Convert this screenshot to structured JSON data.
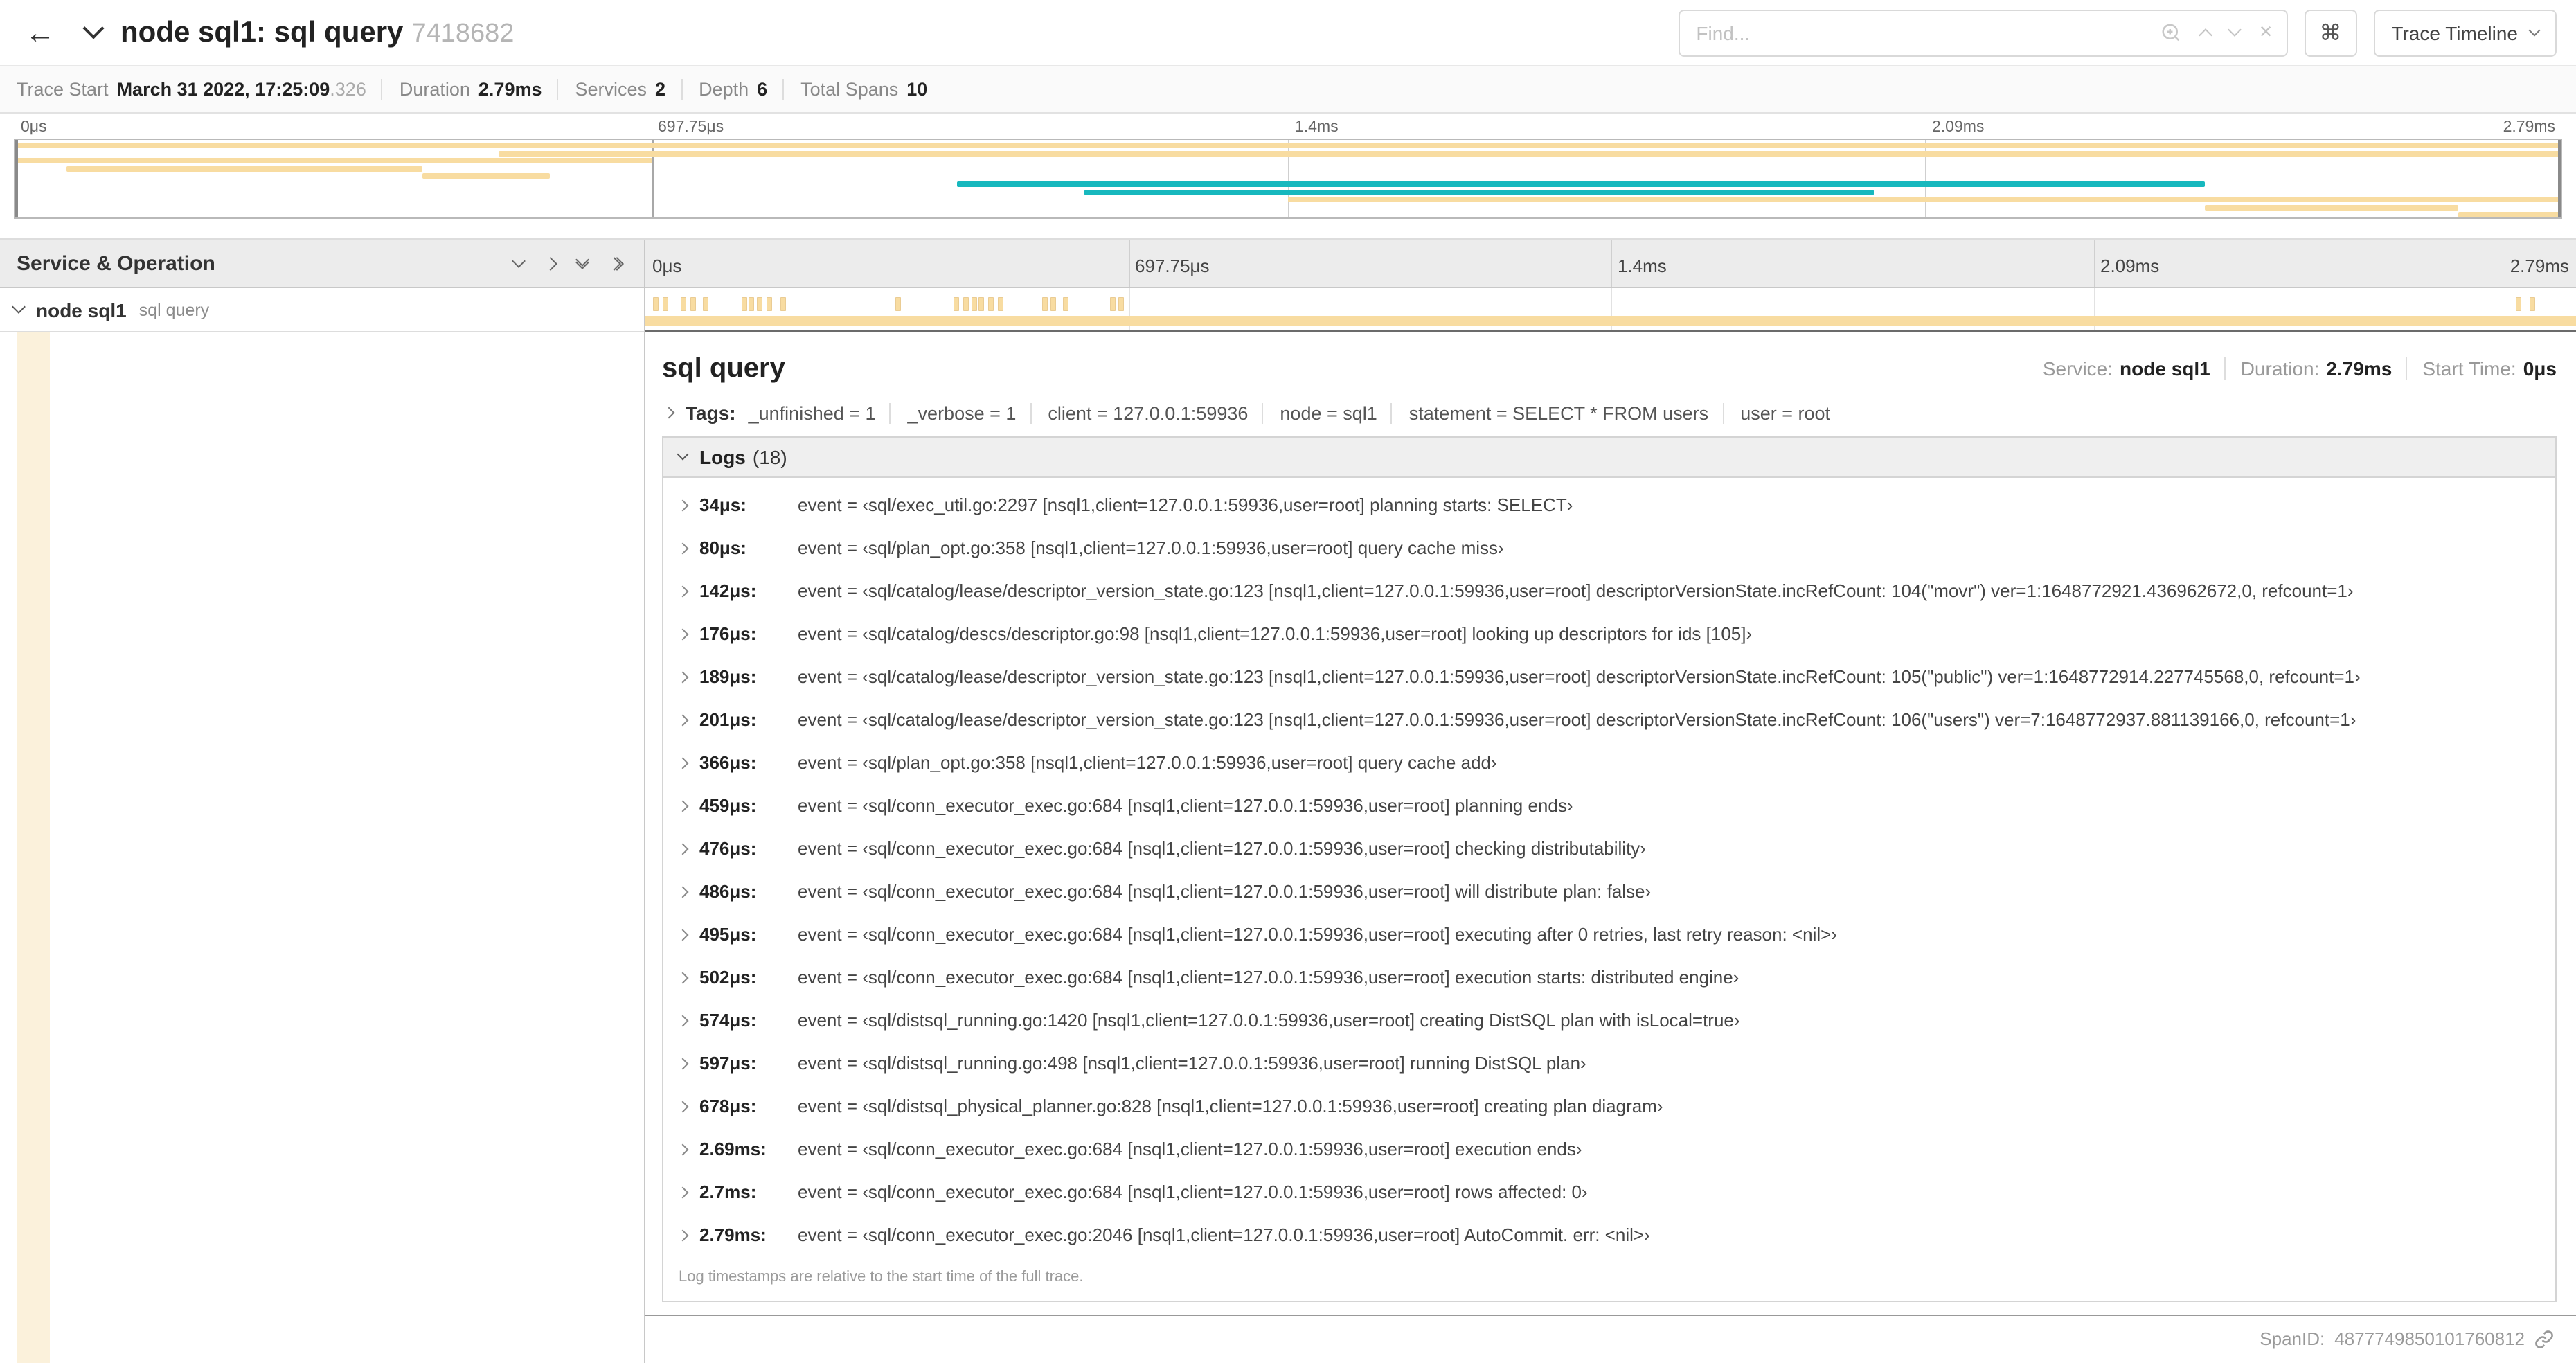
{
  "colors": {
    "tan": "#F8DCA1",
    "teal": "#17B8BE",
    "detail_strip": "#FBF1DB"
  },
  "header": {
    "back_icon": "←",
    "title": "node sql1: sql query",
    "trace_id": "7418682",
    "find_placeholder": "Find...",
    "close_icon": "×",
    "shortcut_icon": "⌘",
    "view_selector": "Trace Timeline"
  },
  "summary": {
    "items": [
      {
        "label": "Trace Start",
        "value": "March 31 2022, 17:25:09",
        "suffix": ".326"
      },
      {
        "label": "Duration",
        "value": "2.79ms"
      },
      {
        "label": "Services",
        "value": "2"
      },
      {
        "label": "Depth",
        "value": "6"
      },
      {
        "label": "Total Spans",
        "value": "10"
      }
    ]
  },
  "minimap": {
    "ticks": [
      {
        "label": "0μs",
        "pos": 0
      },
      {
        "label": "697.75μs",
        "pos": 25
      },
      {
        "label": "1.4ms",
        "pos": 50
      },
      {
        "label": "2.09ms",
        "pos": 75
      },
      {
        "label": "2.79ms",
        "pos": 100,
        "align": "right"
      }
    ],
    "spans": [
      {
        "row": 0,
        "start": 0,
        "end": 100,
        "color": "tan"
      },
      {
        "row": 1,
        "start": 19,
        "end": 100,
        "color": "tan"
      },
      {
        "row": 2,
        "start": 0,
        "end": 25,
        "color": "tan"
      },
      {
        "row": 3,
        "start": 2,
        "end": 16,
        "color": "tan"
      },
      {
        "row": 4,
        "start": 16,
        "end": 21,
        "color": "tan"
      },
      {
        "row": 5,
        "start": 37,
        "end": 86,
        "color": "teal"
      },
      {
        "row": 6,
        "start": 42,
        "end": 73,
        "color": "teal"
      },
      {
        "row": 7,
        "start": 50,
        "end": 100,
        "color": "tan"
      },
      {
        "row": 8,
        "start": 86,
        "end": 96,
        "color": "tan"
      },
      {
        "row": 9,
        "start": 96,
        "end": 100,
        "color": "tan"
      }
    ]
  },
  "timeline": {
    "left_header": "Service & Operation",
    "ticks": [
      {
        "label": "0μs",
        "pos": 0
      },
      {
        "label": "697.75μs",
        "pos": 25
      },
      {
        "label": "1.4ms",
        "pos": 50
      },
      {
        "label": "2.09ms",
        "pos": 75
      },
      {
        "label": "2.79ms",
        "pos": 100,
        "align": "right"
      }
    ],
    "row": {
      "service": "node sql1",
      "operation": "sql query"
    },
    "span_ticks": [
      0.4,
      0.9,
      1.9,
      2.4,
      3.0,
      5.0,
      5.4,
      5.8,
      6.3,
      7.0,
      13.0,
      16.0,
      16.5,
      16.9,
      17.3,
      17.8,
      18.3,
      20.6,
      21.0,
      21.7,
      24.1,
      24.5,
      96.9,
      97.6
    ]
  },
  "detail": {
    "title": "sql query",
    "overview": [
      {
        "label": "Service:",
        "value": "node sql1"
      },
      {
        "label": "Duration:",
        "value": "2.79ms"
      },
      {
        "label": "Start Time:",
        "value": "0μs"
      }
    ],
    "tags_label": "Tags:",
    "tags": [
      "_unfinished = 1",
      "_verbose = 1",
      "client = 127.0.0.1:59936",
      "node = sql1",
      "statement = SELECT * FROM users",
      "user = root"
    ],
    "logs_label": "Logs",
    "logs_count": "(18)",
    "logs": [
      {
        "time": "34μs:",
        "text": "event = ‹sql/exec_util.go:2297 [nsql1,client=127.0.0.1:59936,user=root] planning starts: SELECT›"
      },
      {
        "time": "80μs:",
        "text": "event = ‹sql/plan_opt.go:358 [nsql1,client=127.0.0.1:59936,user=root] query cache miss›"
      },
      {
        "time": "142μs:",
        "text": "event = ‹sql/catalog/lease/descriptor_version_state.go:123 [nsql1,client=127.0.0.1:59936,user=root] descriptorVersionState.incRefCount: 104(\"movr\") ver=1:1648772921.436962672,0, refcount=1›"
      },
      {
        "time": "176μs:",
        "text": "event = ‹sql/catalog/descs/descriptor.go:98 [nsql1,client=127.0.0.1:59936,user=root] looking up descriptors for ids [105]›"
      },
      {
        "time": "189μs:",
        "text": "event = ‹sql/catalog/lease/descriptor_version_state.go:123 [nsql1,client=127.0.0.1:59936,user=root] descriptorVersionState.incRefCount: 105(\"public\") ver=1:1648772914.227745568,0, refcount=1›"
      },
      {
        "time": "201μs:",
        "text": "event = ‹sql/catalog/lease/descriptor_version_state.go:123 [nsql1,client=127.0.0.1:59936,user=root] descriptorVersionState.incRefCount: 106(\"users\") ver=7:1648772937.881139166,0, refcount=1›"
      },
      {
        "time": "366μs:",
        "text": "event = ‹sql/plan_opt.go:358 [nsql1,client=127.0.0.1:59936,user=root] query cache add›"
      },
      {
        "time": "459μs:",
        "text": "event = ‹sql/conn_executor_exec.go:684 [nsql1,client=127.0.0.1:59936,user=root] planning ends›"
      },
      {
        "time": "476μs:",
        "text": "event = ‹sql/conn_executor_exec.go:684 [nsql1,client=127.0.0.1:59936,user=root] checking distributability›"
      },
      {
        "time": "486μs:",
        "text": "event = ‹sql/conn_executor_exec.go:684 [nsql1,client=127.0.0.1:59936,user=root] will distribute plan: false›"
      },
      {
        "time": "495μs:",
        "text": "event = ‹sql/conn_executor_exec.go:684 [nsql1,client=127.0.0.1:59936,user=root] executing after 0 retries, last retry reason: <nil>›"
      },
      {
        "time": "502μs:",
        "text": "event = ‹sql/conn_executor_exec.go:684 [nsql1,client=127.0.0.1:59936,user=root] execution starts: distributed engine›"
      },
      {
        "time": "574μs:",
        "text": "event = ‹sql/distsql_running.go:1420 [nsql1,client=127.0.0.1:59936,user=root] creating DistSQL plan with isLocal=true›"
      },
      {
        "time": "597μs:",
        "text": "event = ‹sql/distsql_running.go:498 [nsql1,client=127.0.0.1:59936,user=root] running DistSQL plan›"
      },
      {
        "time": "678μs:",
        "text": "event = ‹sql/distsql_physical_planner.go:828 [nsql1,client=127.0.0.1:59936,user=root] creating plan diagram›"
      },
      {
        "time": "2.69ms:",
        "text": "event = ‹sql/conn_executor_exec.go:684 [nsql1,client=127.0.0.1:59936,user=root] execution ends›"
      },
      {
        "time": "2.7ms:",
        "text": "event = ‹sql/conn_executor_exec.go:684 [nsql1,client=127.0.0.1:59936,user=root] rows affected: 0›"
      },
      {
        "time": "2.79ms:",
        "text": "event = ‹sql/conn_executor_exec.go:2046 [nsql1,client=127.0.0.1:59936,user=root] AutoCommit. err: <nil>›"
      }
    ],
    "logs_footnote": "Log timestamps are relative to the start time of the full trace.",
    "spanid_label": "SpanID:",
    "spanid_value": "4877749850101760812"
  }
}
